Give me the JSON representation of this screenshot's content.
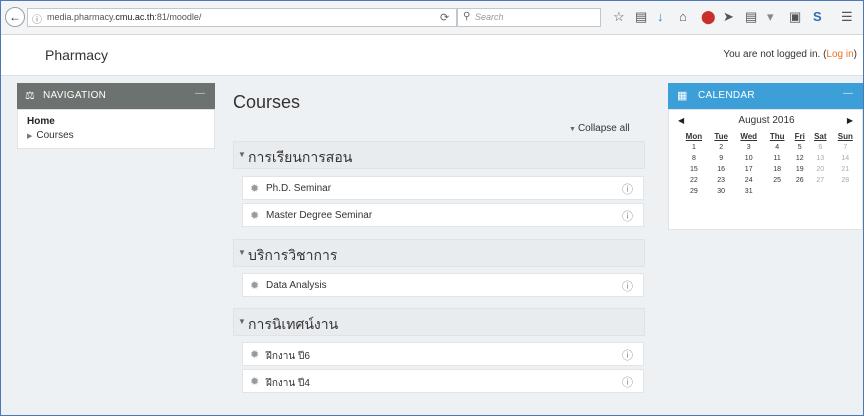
{
  "browser": {
    "url_prefix": "media.pharmacy.",
    "url_domain": "cmu.ac.th",
    "url_suffix": ":81/moodle/",
    "search_placeholder": "Search"
  },
  "header": {
    "site_title": "Pharmacy",
    "login_text": "You are not logged in. (",
    "login_link": "Log in",
    "login_close": ")"
  },
  "navigation": {
    "title": "NAVIGATION",
    "home": "Home",
    "courses": "Courses"
  },
  "main": {
    "title": "Courses",
    "collapse_all": "Collapse all",
    "categories": [
      {
        "name": "การเรียนการสอน",
        "courses": [
          "Ph.D. Seminar",
          "Master Degree Seminar"
        ]
      },
      {
        "name": "บริการวิชาการ",
        "courses": [
          "Data Analysis"
        ]
      },
      {
        "name": "การนิเทศน์งาน",
        "courses": [
          "ฝึกงาน ปี6",
          "ฝึกงาน ปี4"
        ]
      }
    ]
  },
  "calendar": {
    "title": "CALENDAR",
    "month": "August 2016",
    "days": [
      "Mon",
      "Tue",
      "Wed",
      "Thu",
      "Fri",
      "Sat",
      "Sun"
    ],
    "weeks": [
      [
        "1",
        "2",
        "3",
        "4",
        "5",
        "6",
        "7"
      ],
      [
        "8",
        "9",
        "10",
        "11",
        "12",
        "13",
        "14"
      ],
      [
        "15",
        "16",
        "17",
        "18",
        "19",
        "20",
        "21"
      ],
      [
        "22",
        "23",
        "24",
        "25",
        "26",
        "27",
        "28"
      ],
      [
        "29",
        "30",
        "31",
        "",
        "",
        "",
        ""
      ]
    ]
  },
  "colors": {
    "nav_header": "#6c726f",
    "calendar_header": "#3d9fd8",
    "login_link": "#e8711d"
  }
}
